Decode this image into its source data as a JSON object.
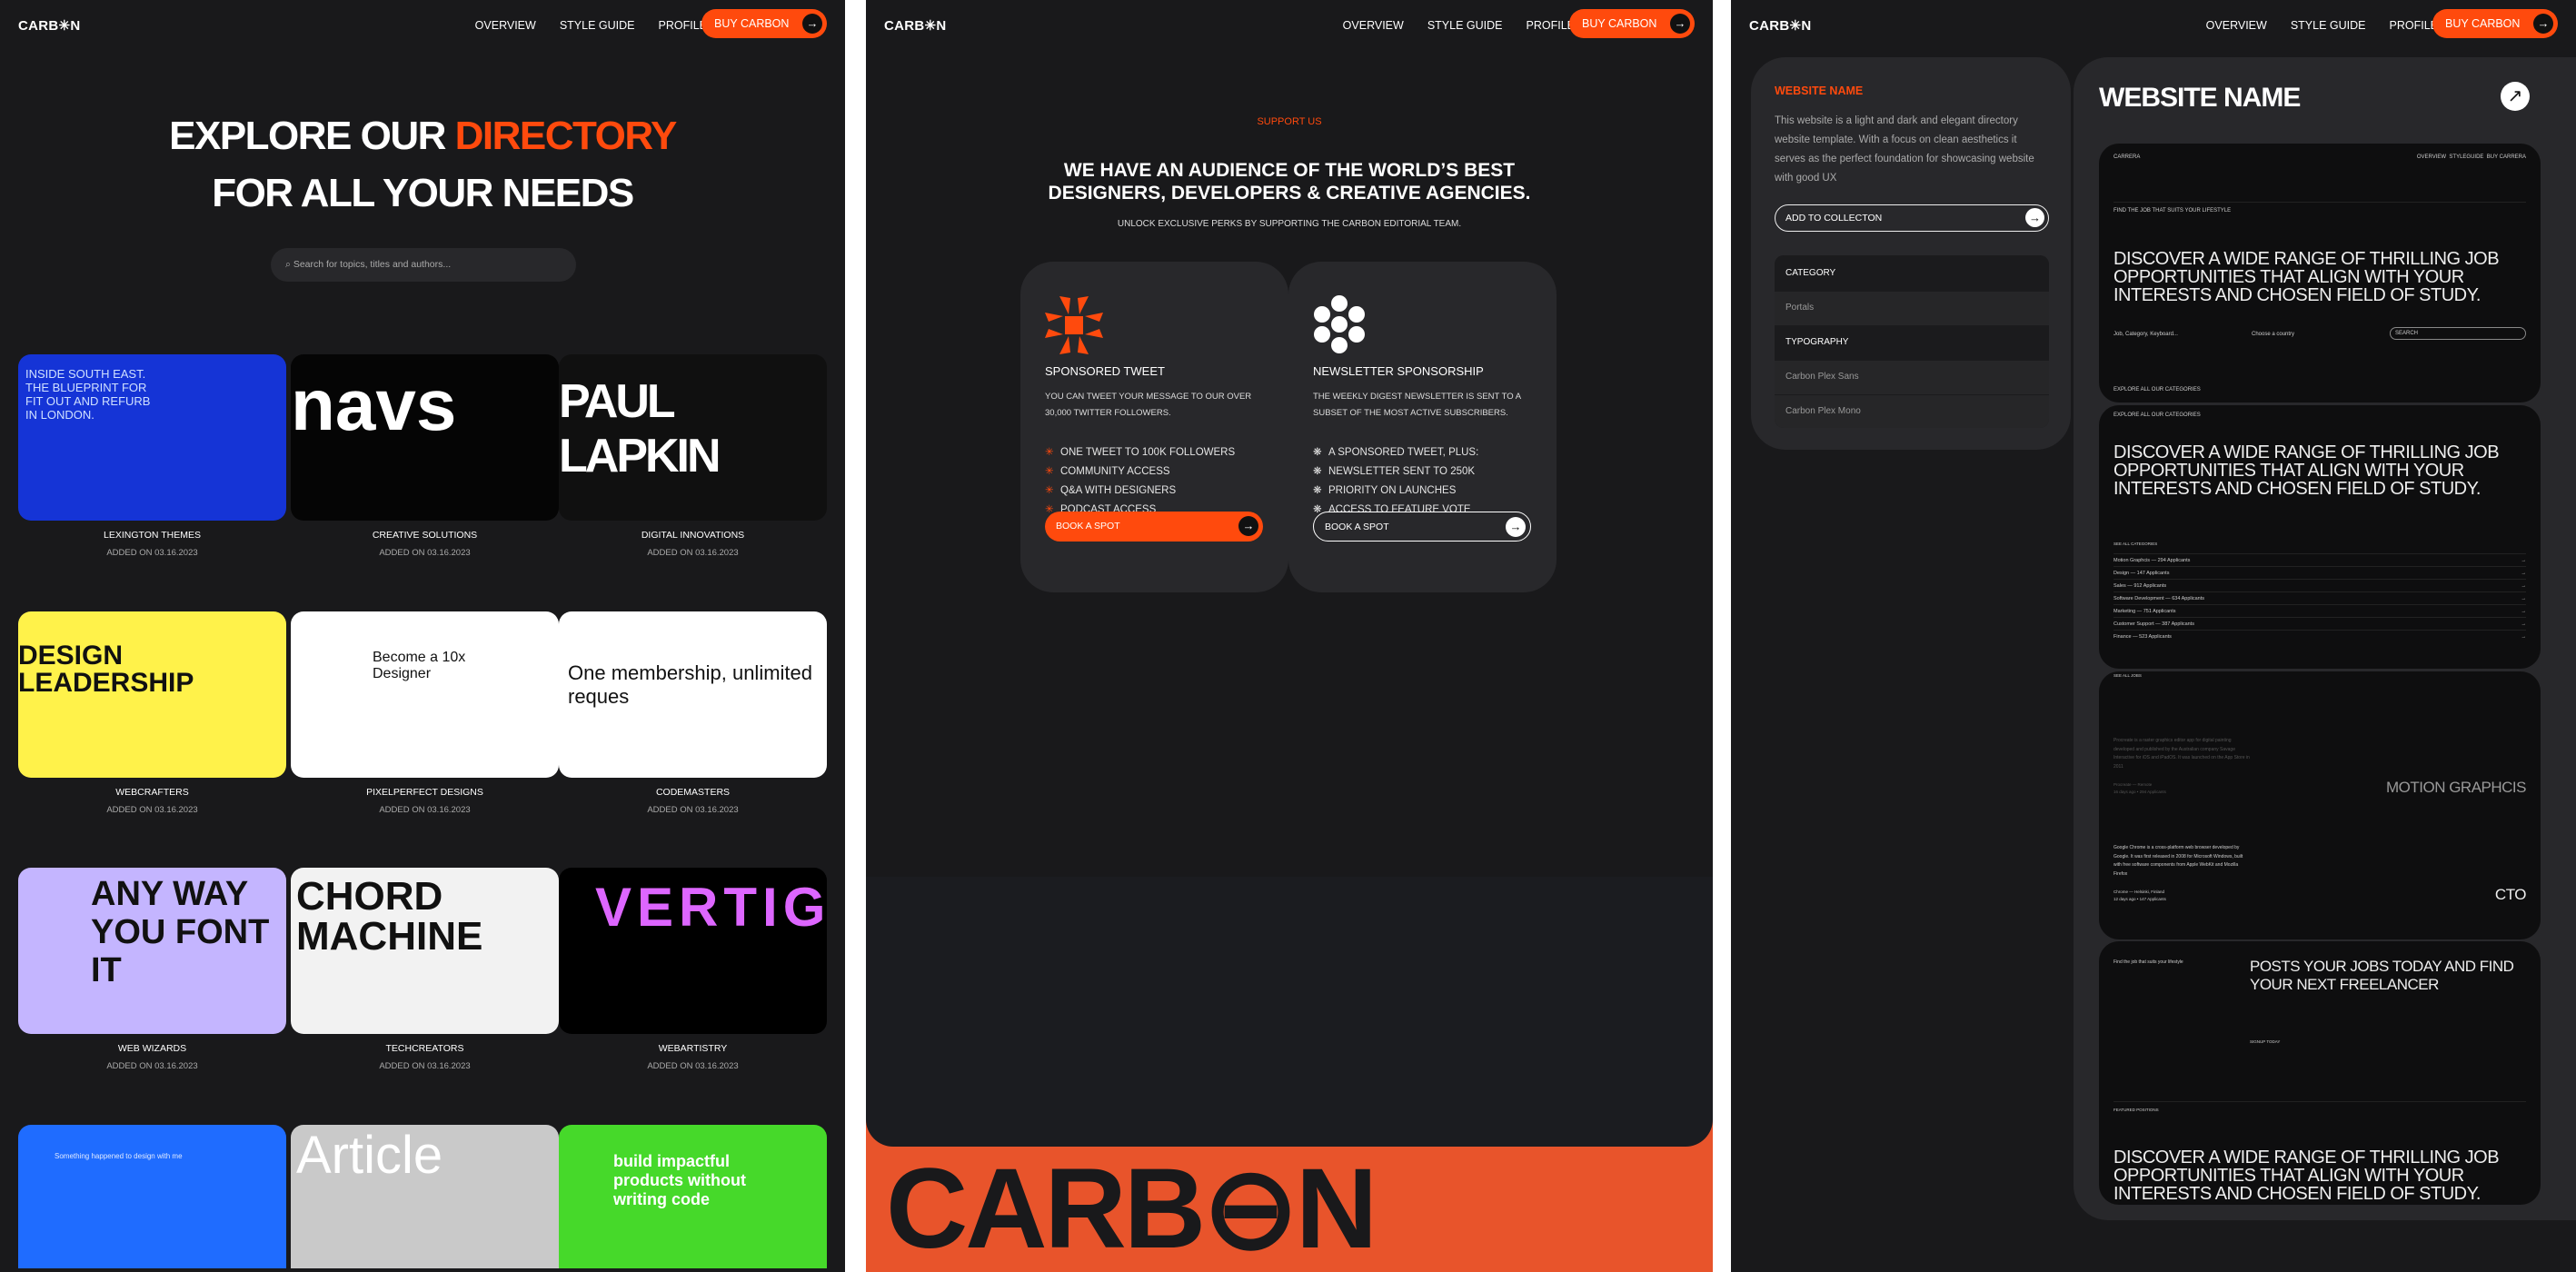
{
  "brand": {
    "logo": "CARB✳N",
    "accent": "#ff4a0d",
    "footer_orange": "#e8542b"
  },
  "nav": {
    "items": [
      "OVERVIEW",
      "STYLE GUIDE",
      "PROFILE"
    ],
    "cta": "BUY CARBON"
  },
  "directory": {
    "headline_white": "EXPLORE OUR ",
    "headline_orange": "DIRECTORY",
    "headline_line2": "FOR ALL YOUR NEEDS",
    "search_placeholder": "Search for topics, titles and authors...",
    "cards": [
      {
        "title": "LEXINGTON THEMES",
        "date": "ADDED ON 03.16.2023",
        "thumb": "INSIDE SOUTH EAST. THE BLUEPRINT FOR FIT OUT AND REFURB IN LONDON."
      },
      {
        "title": "CREATIVE SOLUTIONS",
        "date": "ADDED ON 03.16.2023",
        "thumb": "navs"
      },
      {
        "title": "DIGITAL INNOVATIONS",
        "date": "ADDED ON 03.16.2023",
        "thumb": "PAUL LAPKIN"
      },
      {
        "title": "WEBCRAFTERS",
        "date": "ADDED ON 03.16.2023",
        "thumb": "DESIGN LEADERSHIP"
      },
      {
        "title": "PIXELPERFECT DESIGNS",
        "date": "ADDED ON 03.16.2023",
        "thumb": "Become a 10x Designer"
      },
      {
        "title": "CODEMASTERS",
        "date": "ADDED ON 03.16.2023",
        "thumb": "One membership, unlimited reques"
      },
      {
        "title": "WEB WIZARDS",
        "date": "ADDED ON 03.16.2023",
        "thumb": "ANY WAY YOU FONT IT"
      },
      {
        "title": "TECHCREATORS",
        "date": "ADDED ON 03.16.2023",
        "thumb": "CHORD MACHINE"
      },
      {
        "title": "WEBARTISTRY",
        "date": "ADDED ON 03.16.2023",
        "thumb": "VERTIGO"
      },
      {
        "thumb": "Something happened to design with me"
      },
      {
        "thumb": "Article"
      },
      {
        "thumb": "build impactful products without writing code"
      }
    ]
  },
  "support": {
    "eyebrow": "SUPPORT US",
    "headline1": "WE HAVE AN AUDIENCE OF THE WORLD’S BEST",
    "headline2": "DESIGNERS, DEVELOPERS & CREATIVE AGENCIES.",
    "subtitle": "UNLOCK EXCLUSIVE PERKS BY SUPPORTING THE CARBON EDITORIAL TEAM.",
    "offers": [
      {
        "title": "SPONSORED TWEET",
        "desc": "YOU CAN TWEET YOUR MESSAGE TO OUR OVER 30,000 TWITTER FOLLOWERS.",
        "perks": [
          "ONE TWEET TO 100K FOLLOWERS",
          "COMMUNITY ACCESS",
          "Q&A WITH DESIGNERS",
          "PODCAST ACCESS"
        ],
        "button": "BOOK A SPOT"
      },
      {
        "title": "NEWSLETTER SPONSORSHIP",
        "desc": "THE WEEKLY DIGEST NEWSLETTER IS SENT TO A SUBSET OF THE MOST ACTIVE SUBSCRIBERS.",
        "perks": [
          "A SPONSORED TWEET, PLUS:",
          "NEWSLETTER SENT TO 250K",
          "PRIORITY ON LAUNCHES",
          "ACCESS TO FEATURE VOTE"
        ],
        "button": "BOOK A SPOT"
      }
    ],
    "footer_word": "CARB⊖N"
  },
  "detail": {
    "side_title": "WEBSITE NAME",
    "description": "This website is a light and dark and elegant directory website template. With a focus on clean aesthetics it serves as the perfect foundation for showcasing website with good UX",
    "add_button": "ADD TO COLLECTON",
    "meta": [
      {
        "label": "CATEGORY",
        "value": "Portals"
      },
      {
        "label": "TYPOGRAPHY",
        "values": [
          "Carbon Plex Sans",
          "Carbon Plex Mono"
        ]
      }
    ],
    "title": "WEBSITE NAME",
    "preview": {
      "logo": "CARRERA",
      "nav": [
        "OVERVIEW",
        "STYLEGUIDE",
        "BUY CARRERA"
      ],
      "eyebrow": "FIND THE JOB THAT SUITS YOUR LIFESTYLE",
      "hero": "DISCOVER A WIDE RANGE OF THRILLING JOB OPPORTUNITIES THAT ALIGN WITH YOUR INTERESTS AND CHOSEN FIELD OF STUDY.",
      "job_placeholder": "Job, Category, Keyboard...",
      "country_placeholder": "Choose a country",
      "search": "SEARCH",
      "explore": "EXPLORE ALL OUR CATEGORIES",
      "see_categories": "SEE ALL CATEGORIES",
      "categories": [
        "Motion Graphcis — 294 Applicants",
        "Design — 147 Applicants",
        "Sales — 912 Applicants",
        "Software Development — 634 Applicants",
        "Marketing — 751 Applicants",
        "Customer Support — 387 Applicants",
        "Finance — 523 Applicants"
      ],
      "see_jobs": "SEE ALL JOBS",
      "jobs": [
        {
          "desc": "Procreate is a raster graphics editor app for digital painting developed and published by the Australian company Savage Interactive for iOS and iPadOS. It was launched on the App Store in 2011",
          "company": "Procreate — Remote",
          "meta": "16 days ago • 294 Applicants",
          "role": "MOTION GRAPHCIS"
        },
        {
          "desc": "Google Chrome is a cross-platform web browser developed by Google. It was first released in 2008 for Microsoft Windows, built with free software components from Apple WebKit and Mozilla Firefox",
          "company": "Chrome — Helsinki, Finland",
          "meta": "12 days ago • 147 Applicants",
          "role": "CTO"
        }
      ],
      "find": "Find the job that suits your lifestyle",
      "post": "POSTS YOUR JOBS TODAY AND FIND YOUR NEXT FREELANCER",
      "signup": "SIGNUP TODAY",
      "featured": "FEATURED POSITIONS"
    }
  }
}
